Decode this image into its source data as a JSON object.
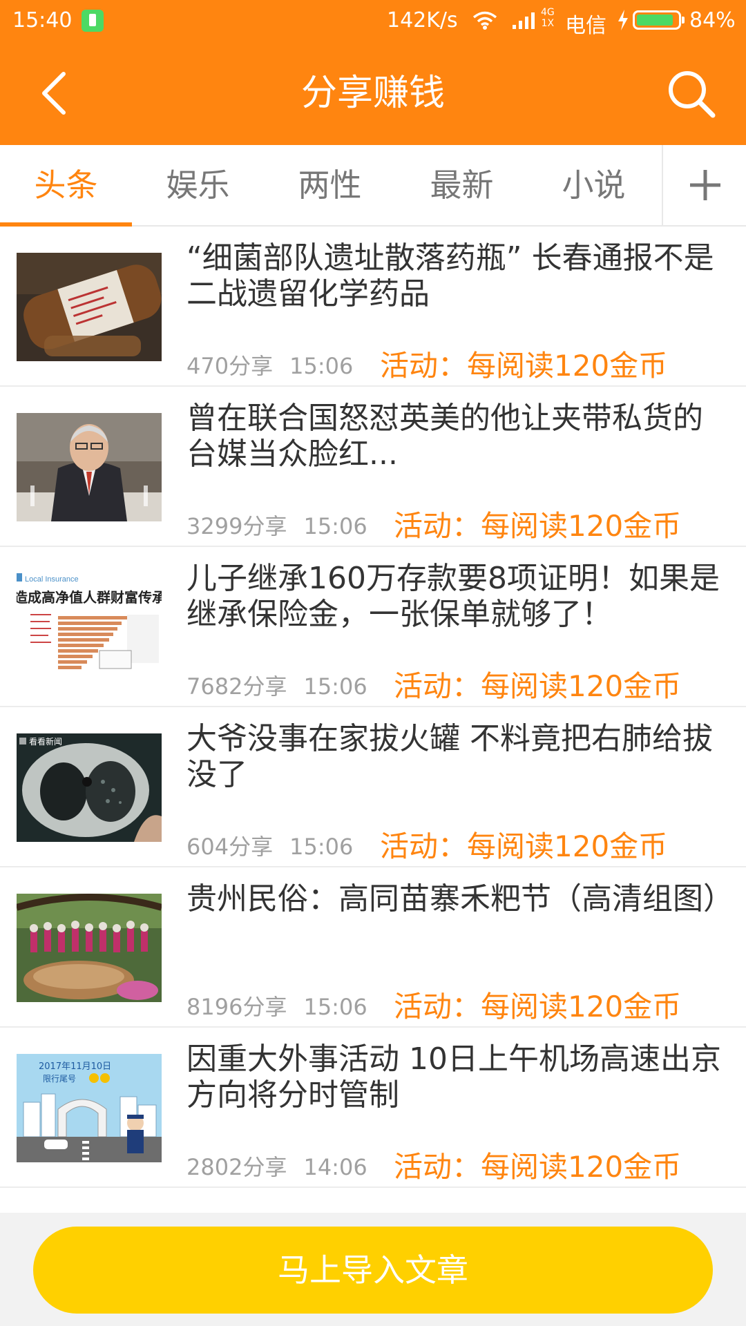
{
  "status_bar": {
    "time": "15:40",
    "net_speed": "142K/s",
    "net_type_top": "4G",
    "net_type_bottom": "1X",
    "carrier": "电信",
    "battery": "84%"
  },
  "header": {
    "title": "分享赚钱",
    "back_icon": "chevron-left-icon",
    "search_icon": "search-icon",
    "color": "#ff8510"
  },
  "tabs": [
    {
      "label": "头条",
      "active": true
    },
    {
      "label": "娱乐",
      "active": false
    },
    {
      "label": "两性",
      "active": false
    },
    {
      "label": "最新",
      "active": false
    },
    {
      "label": "小说",
      "active": false
    }
  ],
  "articles": [
    {
      "title": "“细菌部队遗址散落药瓶” 长春通报不是二战遗留化学药品",
      "shares": "470分享",
      "time": "15:06",
      "promo": "活动：每阅读120金币"
    },
    {
      "title": "曾在联合国怒怼英美的他让夹带私货的台媒当众脸红...",
      "shares": "3299分享",
      "time": "15:06",
      "promo": "活动：每阅读120金币"
    },
    {
      "title": "儿子继承160万存款要8项证明！如果是继承保险金，一张保单就够了！",
      "shares": "7682分享",
      "time": "15:06",
      "promo": "活动：每阅读120金币"
    },
    {
      "title": "大爷没事在家拔火罐 不料竟把右肺给拔没了",
      "shares": "604分享",
      "time": "15:06",
      "promo": "活动：每阅读120金币"
    },
    {
      "title": "贵州民俗：高同苗寨禾粑节（高清组图）",
      "shares": "8196分享",
      "time": "15:06",
      "promo": "活动：每阅读120金币"
    },
    {
      "title": "因重大外事活动 10日上午机场高速出京方向将分时管制",
      "shares": "2802分享",
      "time": "14:06",
      "promo": "活动：每阅读120金币"
    }
  ],
  "thumbnails": {
    "insurance_label": "Local Insurance",
    "insurance_headline": "造成高净值人群财富传承首",
    "news_label": "看看新闻",
    "traffic_date": "2017年11月10日",
    "traffic_label": "限行尾号"
  },
  "bottom": {
    "import_label": "马上导入文章",
    "color": "#ffd000"
  }
}
